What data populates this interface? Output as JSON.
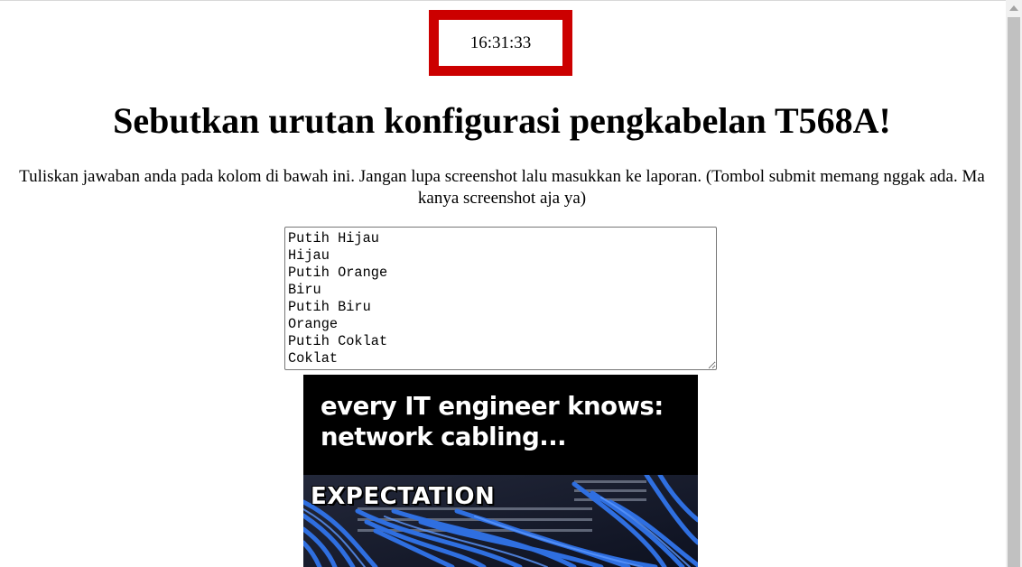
{
  "clock": {
    "time": "16:31:33"
  },
  "question": {
    "title": "Sebutkan urutan konfigurasi pengkabelan T568A!",
    "instructions": "Tuliskan jawaban anda pada kolom di bawah ini. Jangan lupa screenshot lalu masukkan ke laporan. (Tombol submit memang nggak ada. Ma kanya screenshot aja ya)"
  },
  "answer": {
    "value": "Putih Hijau\nHijau\nPutih Orange\nBiru\nPutih Biru\nOrange\nPutih Coklat\nCoklat"
  },
  "meme": {
    "caption_line1": "every IT engineer knows:",
    "caption_line2": "network cabling...",
    "label": "EXPECTATION"
  },
  "colors": {
    "clock_border": "#cc0000",
    "cable_blue": "#2f6fe0"
  },
  "icons": {
    "scroll_up": "chevron-up-icon",
    "resize": "resize-grip-icon"
  }
}
